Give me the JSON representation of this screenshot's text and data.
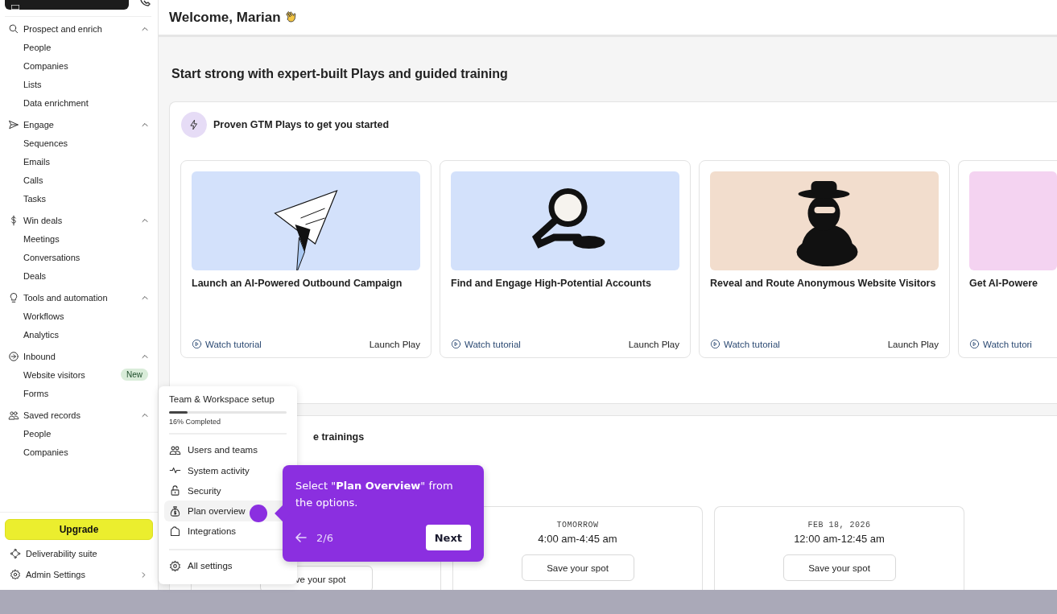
{
  "sidebar": {
    "sections": [
      {
        "label": "Prospect and enrich",
        "expanded": true,
        "items": [
          {
            "label": "People"
          },
          {
            "label": "Companies"
          },
          {
            "label": "Lists"
          },
          {
            "label": "Data enrichment"
          }
        ]
      },
      {
        "label": "Engage",
        "expanded": true,
        "items": [
          {
            "label": "Sequences"
          },
          {
            "label": "Emails"
          },
          {
            "label": "Calls"
          },
          {
            "label": "Tasks"
          }
        ]
      },
      {
        "label": "Win deals",
        "expanded": true,
        "items": [
          {
            "label": "Meetings"
          },
          {
            "label": "Conversations"
          },
          {
            "label": "Deals"
          }
        ]
      },
      {
        "label": "Tools and automation",
        "expanded": true,
        "items": [
          {
            "label": "Workflows"
          },
          {
            "label": "Analytics"
          }
        ]
      },
      {
        "label": "Inbound",
        "expanded": true,
        "items": [
          {
            "label": "Website visitors",
            "badge": "New"
          },
          {
            "label": "Forms"
          }
        ]
      },
      {
        "label": "Saved records",
        "expanded": true,
        "items": [
          {
            "label": "People"
          },
          {
            "label": "Companies"
          }
        ]
      }
    ],
    "upgrade_button": "Upgrade",
    "footer_items": [
      {
        "label": "Deliverability suite"
      },
      {
        "label": "Admin Settings"
      }
    ]
  },
  "header": {
    "title": "Welcome, Marian"
  },
  "plays": {
    "heading": "Start strong with expert-built Plays and guided training",
    "panel_title": "Proven GTM Plays to get you started",
    "cards": [
      {
        "title": "Launch an AI-Powered Outbound Campaign",
        "color": "#d3e1fb",
        "watch_label": "Watch tutorial",
        "launch_label": "Launch Play"
      },
      {
        "title": "Find and Engage High-Potential Accounts",
        "color": "#d3e1fb",
        "watch_label": "Watch tutorial",
        "launch_label": "Launch Play"
      },
      {
        "title": "Reveal and Route Anonymous Website Visitors",
        "color": "#f2ddcd",
        "watch_label": "Watch tutorial",
        "launch_label": "Launch Play"
      },
      {
        "title": "Get AI-Powere",
        "color": "#f4d3f1",
        "watch_label": "Watch tutori"
      }
    ]
  },
  "trainings": {
    "panel_title": "e trainings",
    "cards": [
      {
        "button": "ve your spot"
      },
      {
        "date": "TOMORROW",
        "time": "4:00 am-4:45 am",
        "button": "Save your spot"
      },
      {
        "date": "FEB 18, 2026",
        "time": "12:00 am-12:45 am",
        "button": "Save your spot"
      }
    ]
  },
  "setup_menu": {
    "title": "Team & Workspace setup",
    "progress": {
      "level": 0.16
    },
    "progress_label": "16% Completed",
    "items": [
      {
        "label": "Users and teams",
        "selected": false
      },
      {
        "label": "System activity",
        "selected": false
      },
      {
        "label": "Security",
        "selected": false
      },
      {
        "label": "Plan overview",
        "selected": true
      },
      {
        "label": "Integrations",
        "selected": false
      }
    ],
    "footer_item": "All settings"
  },
  "tour_tooltip": {
    "text": "Select \"**Plan Overview**\" from the options.",
    "step": "2/6",
    "next_button": "Next"
  }
}
